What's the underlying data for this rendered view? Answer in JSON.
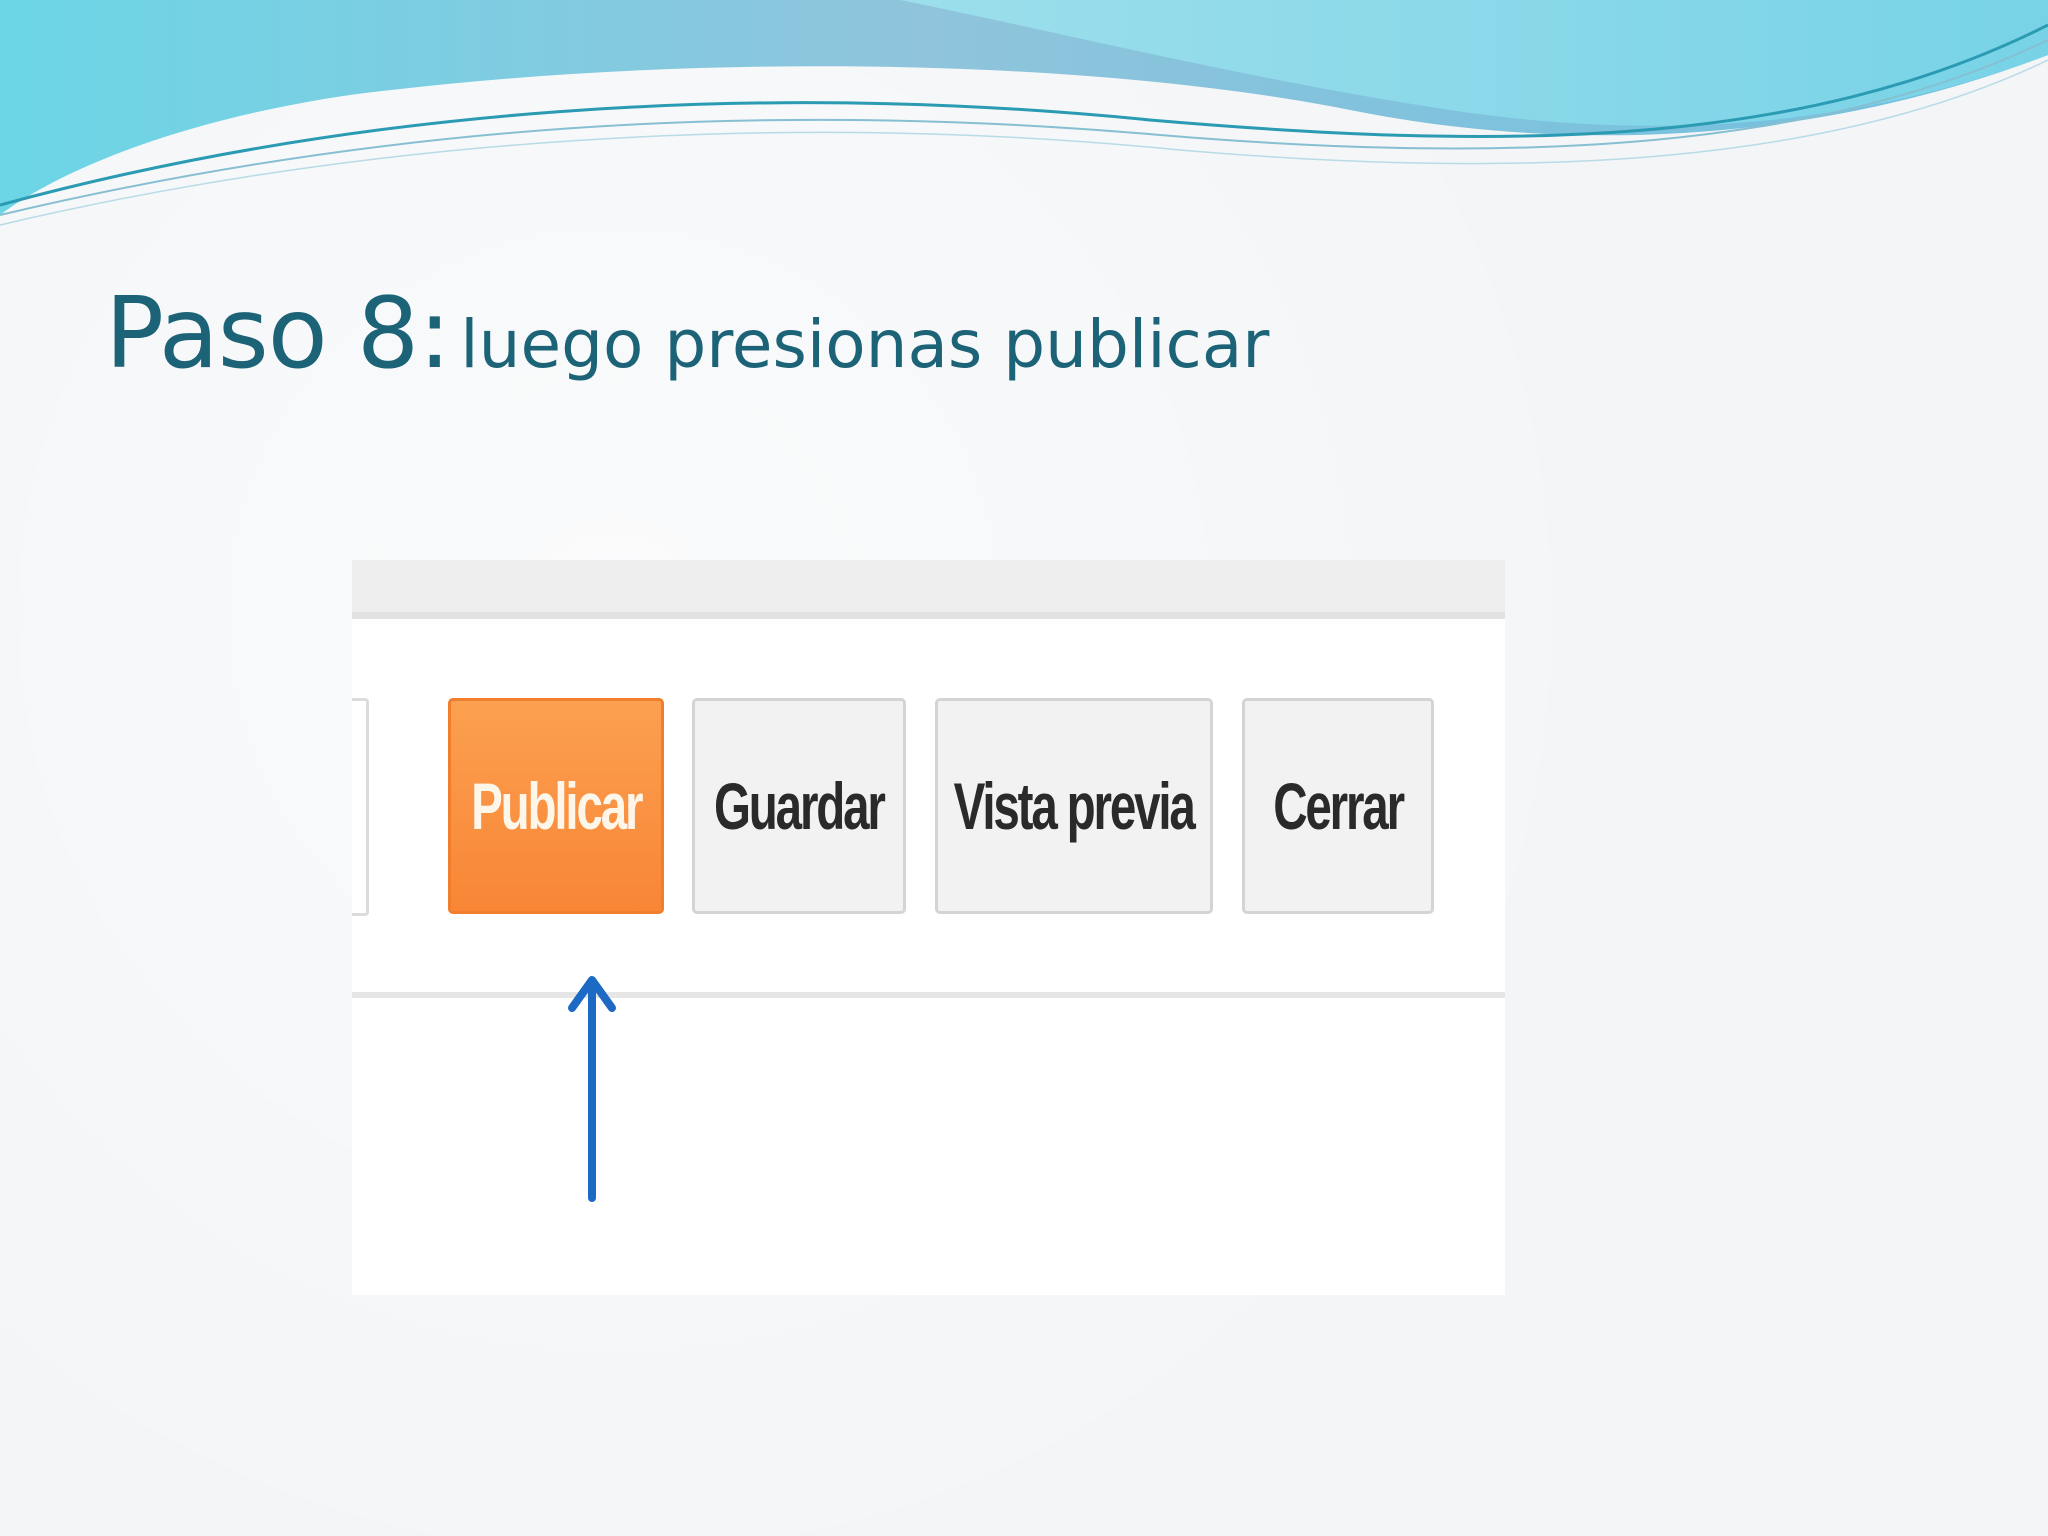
{
  "slide": {
    "title_main": "Paso 8:",
    "title_sub": "luego presionas publicar"
  },
  "toolbar": {
    "publish_label": "Publicar",
    "save_label": "Guardar",
    "preview_label": "Vista previa",
    "close_label": "Cerrar"
  },
  "colors": {
    "title": "#1c6377",
    "publish_button": "#f88636",
    "arrow": "#1d6ac4",
    "wave_teal": "#5fd3e3",
    "wave_blue": "#7fb8d4"
  },
  "icons": {
    "pointer": "arrow-up-icon"
  }
}
